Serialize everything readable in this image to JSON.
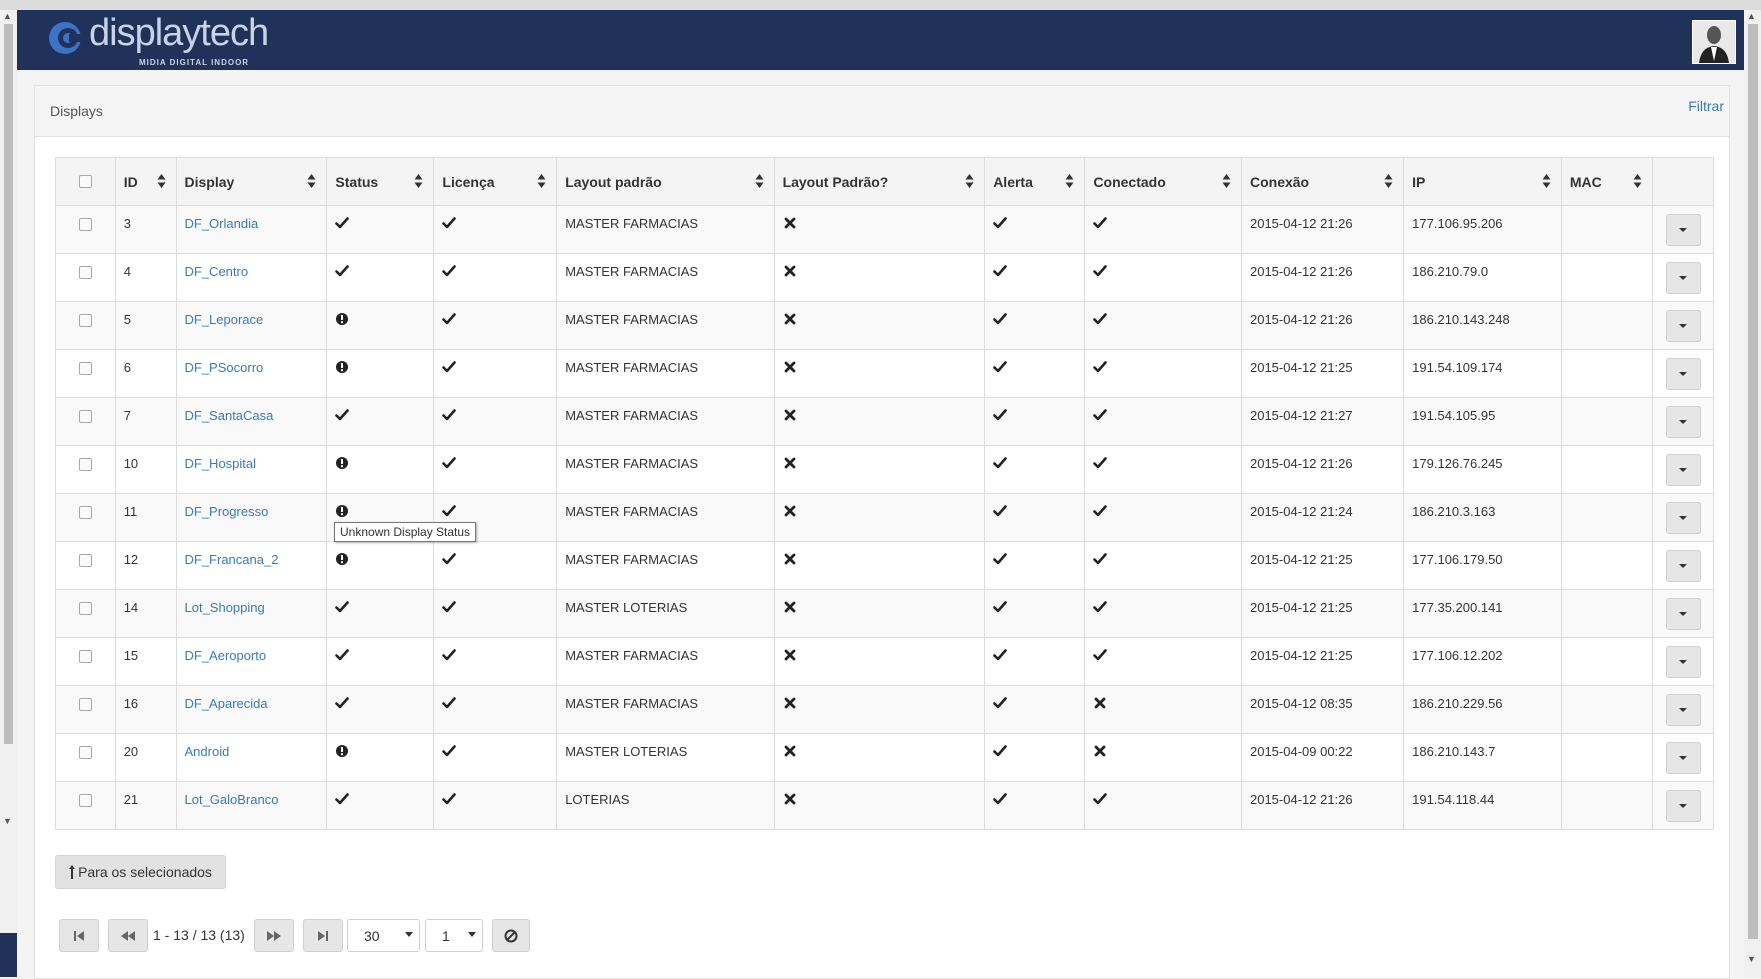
{
  "brand": {
    "name": "displaytech",
    "tagline": "MIDIA DIGITAL INDOOR"
  },
  "panel": {
    "title": "Displays",
    "filter_label": "Filtrar"
  },
  "columns": [
    "ID",
    "Display",
    "Status",
    "Licença",
    "Layout padrão",
    "Layout Padrão?",
    "Alerta",
    "Conectado",
    "Conexão",
    "IP",
    "MAC"
  ],
  "rows": [
    {
      "id": "3",
      "display": "DF_Orlandia",
      "status": "ok",
      "license": "ok",
      "layout": "MASTER FARMACIAS",
      "layout_default": "no",
      "alert": "ok",
      "connected": "ok",
      "conn": "2015-04-12 21:26",
      "ip": "177.106.95.206",
      "mac": ""
    },
    {
      "id": "4",
      "display": "DF_Centro",
      "status": "ok",
      "license": "ok",
      "layout": "MASTER FARMACIAS",
      "layout_default": "no",
      "alert": "ok",
      "connected": "ok",
      "conn": "2015-04-12 21:26",
      "ip": "186.210.79.0",
      "mac": ""
    },
    {
      "id": "5",
      "display": "DF_Leporace",
      "status": "unknown",
      "license": "ok",
      "layout": "MASTER FARMACIAS",
      "layout_default": "no",
      "alert": "ok",
      "connected": "ok",
      "conn": "2015-04-12 21:26",
      "ip": "186.210.143.248",
      "mac": ""
    },
    {
      "id": "6",
      "display": "DF_PSocorro",
      "status": "unknown",
      "license": "ok",
      "layout": "MASTER FARMACIAS",
      "layout_default": "no",
      "alert": "ok",
      "connected": "ok",
      "conn": "2015-04-12 21:25",
      "ip": "191.54.109.174",
      "mac": ""
    },
    {
      "id": "7",
      "display": "DF_SantaCasa",
      "status": "ok",
      "license": "ok",
      "layout": "MASTER FARMACIAS",
      "layout_default": "no",
      "alert": "ok",
      "connected": "ok",
      "conn": "2015-04-12 21:27",
      "ip": "191.54.105.95",
      "mac": ""
    },
    {
      "id": "10",
      "display": "DF_Hospital",
      "status": "unknown",
      "license": "ok",
      "layout": "MASTER FARMACIAS",
      "layout_default": "no",
      "alert": "ok",
      "connected": "ok",
      "conn": "2015-04-12 21:26",
      "ip": "179.126.76.245",
      "mac": ""
    },
    {
      "id": "11",
      "display": "DF_Progresso",
      "status": "unknown",
      "license": "ok",
      "layout": "MASTER FARMACIAS",
      "layout_default": "no",
      "alert": "ok",
      "connected": "ok",
      "conn": "2015-04-12 21:24",
      "ip": "186.210.3.163",
      "mac": ""
    },
    {
      "id": "12",
      "display": "DF_Francana_2",
      "status": "unknown",
      "license": "ok",
      "layout": "MASTER FARMACIAS",
      "layout_default": "no",
      "alert": "ok",
      "connected": "ok",
      "conn": "2015-04-12 21:25",
      "ip": "177.106.179.50",
      "mac": ""
    },
    {
      "id": "14",
      "display": "Lot_Shopping",
      "status": "ok",
      "license": "ok",
      "layout": "MASTER LOTERIAS",
      "layout_default": "no",
      "alert": "ok",
      "connected": "ok",
      "conn": "2015-04-12 21:25",
      "ip": "177.35.200.141",
      "mac": ""
    },
    {
      "id": "15",
      "display": "DF_Aeroporto",
      "status": "ok",
      "license": "ok",
      "layout": "MASTER FARMACIAS",
      "layout_default": "no",
      "alert": "ok",
      "connected": "ok",
      "conn": "2015-04-12 21:25",
      "ip": "177.106.12.202",
      "mac": ""
    },
    {
      "id": "16",
      "display": "DF_Aparecida",
      "status": "ok",
      "license": "ok",
      "layout": "MASTER FARMACIAS",
      "layout_default": "no",
      "alert": "ok",
      "connected": "no",
      "conn": "2015-04-12 08:35",
      "ip": "186.210.229.56",
      "mac": ""
    },
    {
      "id": "20",
      "display": "Android",
      "status": "unknown",
      "license": "ok",
      "layout": "MASTER LOTERIAS",
      "layout_default": "no",
      "alert": "ok",
      "connected": "no",
      "conn": "2015-04-09 00:22",
      "ip": "186.210.143.7",
      "mac": ""
    },
    {
      "id": "21",
      "display": "Lot_GaloBranco",
      "status": "ok",
      "license": "ok",
      "layout": "LOTERIAS",
      "layout_default": "no",
      "alert": "ok",
      "connected": "ok",
      "conn": "2015-04-12 21:26",
      "ip": "191.54.118.44",
      "mac": ""
    }
  ],
  "tooltip": "Unknown Display Status",
  "bulk_label": "Para os selecionados",
  "pager": {
    "info": "1 - 13 / 13 (13)",
    "page_size": "30",
    "page": "1"
  },
  "icons": {
    "ok": "check-icon",
    "no": "times-icon",
    "unknown": "exclamation-circle-icon"
  },
  "colors": {
    "header_bg": "#20325a",
    "link": "#3a7ab8"
  }
}
